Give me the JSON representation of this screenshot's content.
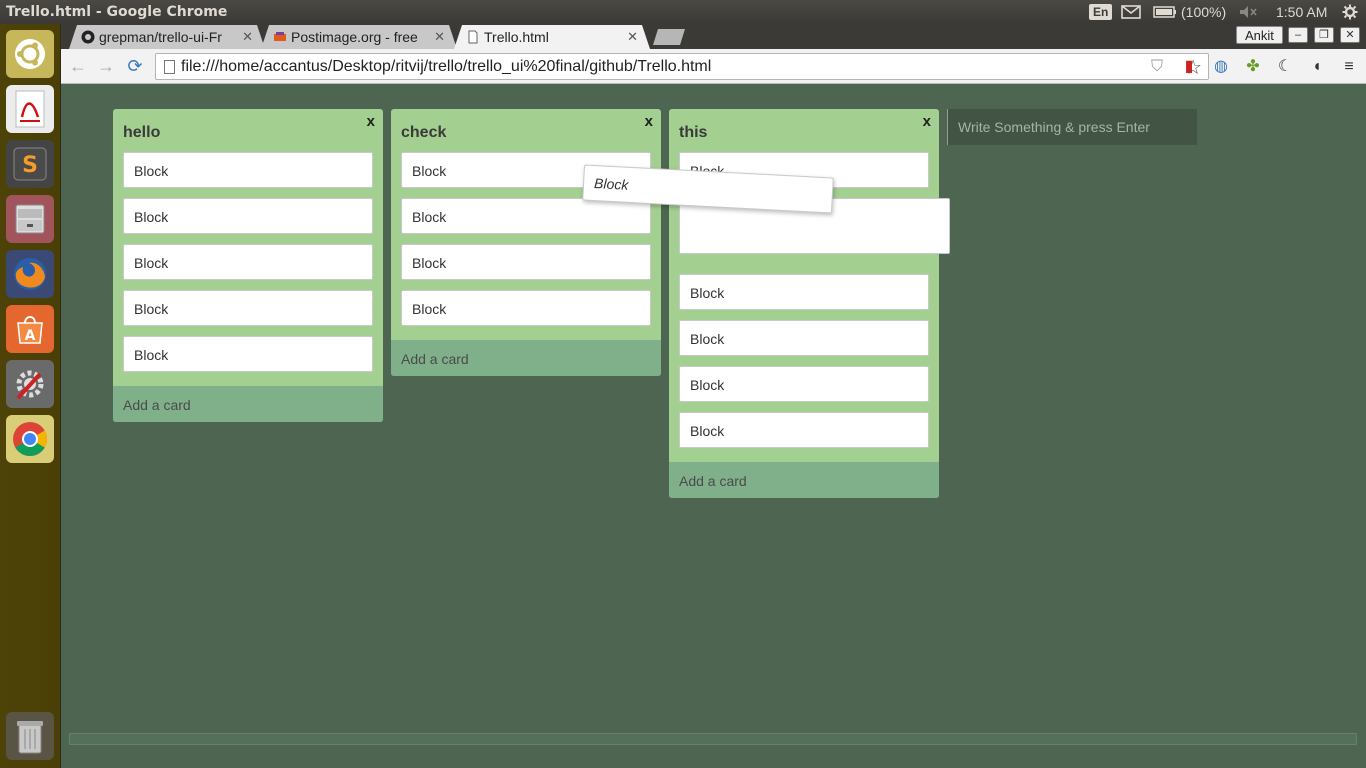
{
  "os_panel": {
    "window_title": "Trello.html - Google Chrome",
    "lang": "En",
    "battery": "(100%)",
    "clock": "1:50 AM"
  },
  "launcher": {
    "items": [
      "ubuntu-dash-icon",
      "pdf-viewer-icon",
      "sublime-text-icon",
      "file-manager-icon",
      "firefox-icon",
      "software-center-icon",
      "system-settings-icon",
      "chrome-icon",
      "trash-icon"
    ]
  },
  "browser": {
    "tabs": [
      {
        "label": "grepman/trello-ui-Fr"
      },
      {
        "label": "Postimage.org - free"
      },
      {
        "label": "Trello.html"
      }
    ],
    "profile": "Ankit",
    "url": "file:///home/accantus/Desktop/ritvij/trello/trello_ui%20final/github/Trello.html"
  },
  "board": {
    "lists": [
      {
        "title": "hello",
        "close": "x",
        "cards": [
          "Block",
          "Block",
          "Block",
          "Block",
          "Block"
        ],
        "add_card": "Add a card"
      },
      {
        "title": "check",
        "close": "x",
        "cards": [
          "Block",
          "Block",
          "Block",
          "Block"
        ],
        "add_card": "Add a card"
      },
      {
        "title": "this",
        "close": "x",
        "cards_before": [
          "Block"
        ],
        "cards_after": [
          "Block",
          "Block",
          "Block",
          "Block"
        ],
        "add_card": "Add a card"
      }
    ],
    "dragging_card": "Block",
    "new_list_placeholder": "Write Something & press Enter"
  },
  "colors": {
    "page_bg": "#4e6552",
    "list_bg": "#a3cf91",
    "add_card_bg": "#7fb08a"
  }
}
